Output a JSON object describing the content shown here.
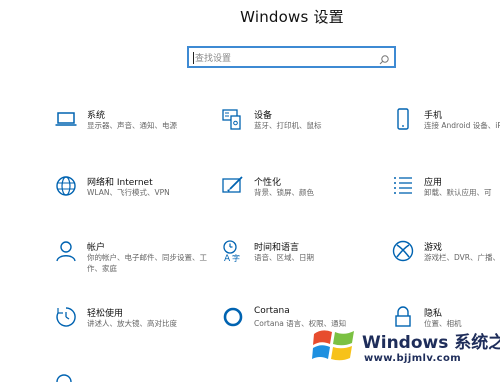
{
  "window": {
    "title": "Windows 设置"
  },
  "search": {
    "placeholder": "查找设置"
  },
  "tiles": [
    {
      "name": "系统",
      "desc": "显示器、声音、通知、电源",
      "icon": "laptop-icon"
    },
    {
      "name": "设备",
      "desc": "蓝牙、打印机、鼠标",
      "icon": "keyboard-icon"
    },
    {
      "name": "手机",
      "desc": "连接 Android 设备、iP",
      "icon": "phone-icon"
    },
    {
      "name": "网络和 Internet",
      "desc": "WLAN、飞行模式、VPN",
      "icon": "globe-icon"
    },
    {
      "name": "个性化",
      "desc": "背景、锁屏、颜色",
      "icon": "paint-icon"
    },
    {
      "name": "应用",
      "desc": "卸载、默认应用、可",
      "icon": "apps-list-icon"
    },
    {
      "name": "帐户",
      "desc": "你的帐户、电子邮件、同步设置、工作、家庭",
      "icon": "person-icon"
    },
    {
      "name": "时间和语言",
      "desc": "语音、区域、日期",
      "icon": "time-language-icon"
    },
    {
      "name": "游戏",
      "desc": "游戏栏、DVR、广播、",
      "icon": "xbox-icon"
    },
    {
      "name": "轻松使用",
      "desc": "讲述人、放大镜、高对比度",
      "icon": "ease-of-access-icon"
    },
    {
      "name": "Cortana",
      "desc": "Cortana 语言、权限、通知",
      "icon": "cortana-icon"
    },
    {
      "name": "隐私",
      "desc": "位置、相机",
      "icon": "lock-icon"
    }
  ],
  "watermark": {
    "main": "Windows 系统之家",
    "url": "www.bjjmlv.com"
  },
  "colors": {
    "accent": "#0063b1",
    "search_border": "#3e8ad3"
  }
}
